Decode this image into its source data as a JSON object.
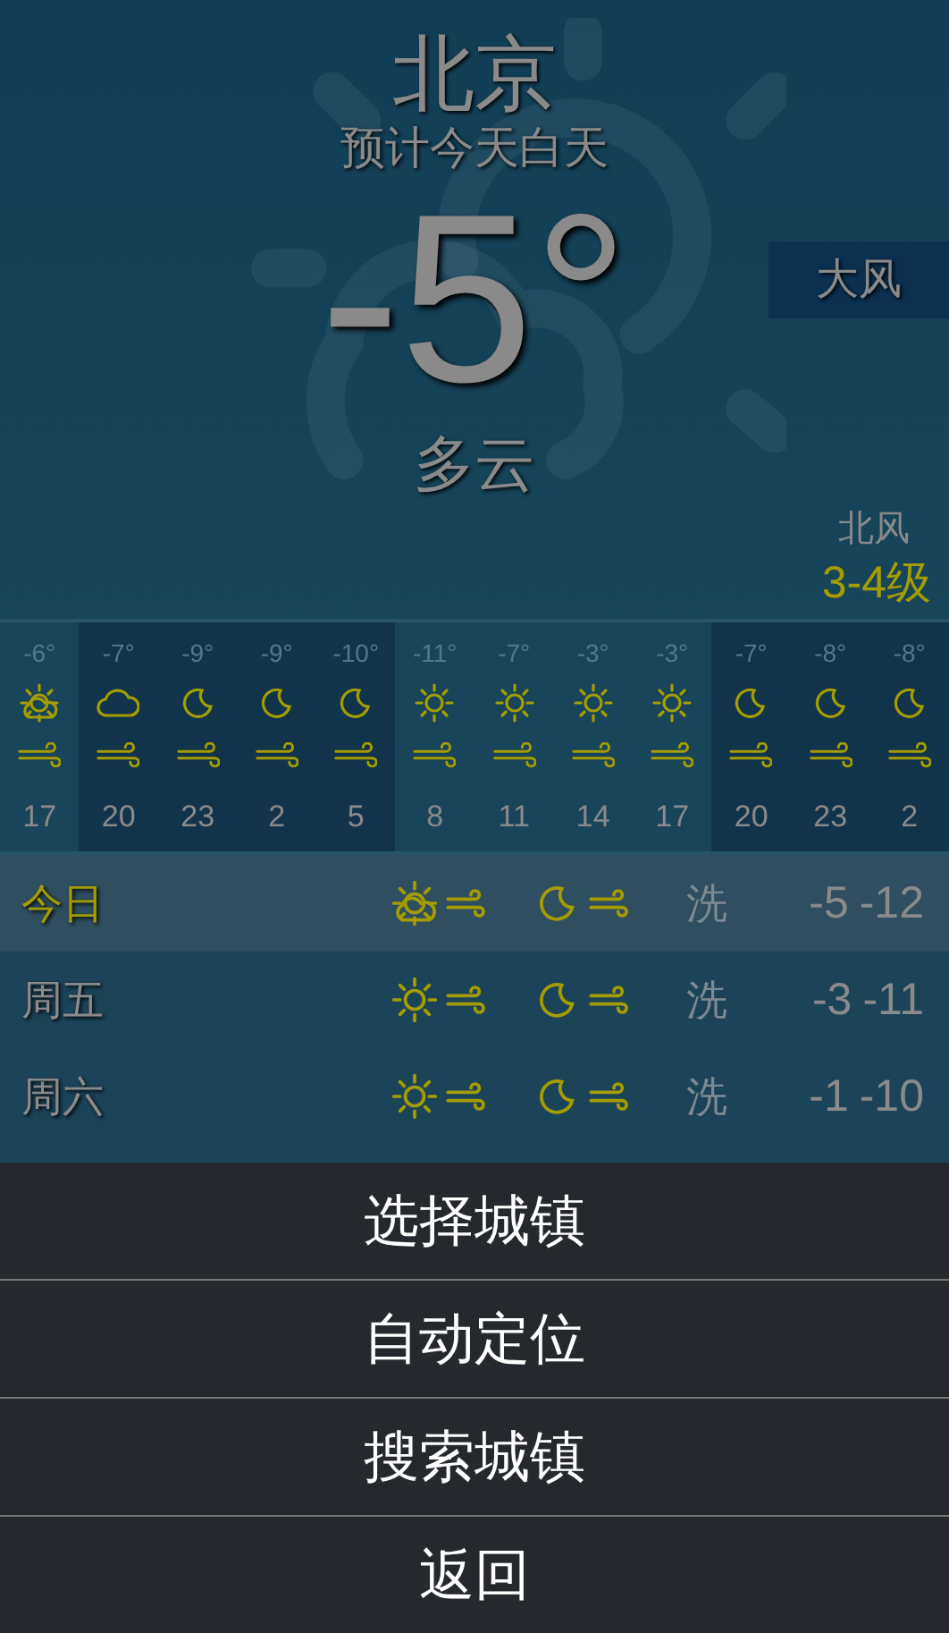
{
  "header": {
    "city": "北京",
    "subtitle": "预计今天白天",
    "temperature": "-5°",
    "condition": "多云",
    "alert": "大风",
    "wind_direction": "北风",
    "wind_level": "3-4级"
  },
  "hourly": [
    {
      "temp": "-6°",
      "kind": "sun-cloud",
      "night": false,
      "hour": "17"
    },
    {
      "temp": "-7°",
      "kind": "cloud",
      "night": true,
      "hour": "20"
    },
    {
      "temp": "-9°",
      "kind": "moon",
      "night": true,
      "hour": "23"
    },
    {
      "temp": "-9°",
      "kind": "moon",
      "night": true,
      "hour": "2"
    },
    {
      "temp": "-10°",
      "kind": "moon",
      "night": true,
      "hour": "5"
    },
    {
      "temp": "-11°",
      "kind": "sun",
      "night": false,
      "hour": "8"
    },
    {
      "temp": "-7°",
      "kind": "sun",
      "night": false,
      "hour": "11"
    },
    {
      "temp": "-3°",
      "kind": "sun",
      "night": false,
      "hour": "14"
    },
    {
      "temp": "-3°",
      "kind": "sun",
      "night": false,
      "hour": "17"
    },
    {
      "temp": "-7°",
      "kind": "moon",
      "night": true,
      "hour": "20"
    },
    {
      "temp": "-8°",
      "kind": "moon",
      "night": true,
      "hour": "23"
    },
    {
      "temp": "-8°",
      "kind": "moon",
      "night": true,
      "hour": "2"
    }
  ],
  "daily": [
    {
      "day": "今日",
      "selected": true,
      "day_weather": {
        "kind": "sun-cloud"
      },
      "night_weather": {
        "kind": "moon"
      },
      "index": "洗",
      "high": "-5",
      "low": "-12"
    },
    {
      "day": "周五",
      "selected": false,
      "day_weather": {
        "kind": "sun"
      },
      "night_weather": {
        "kind": "moon"
      },
      "index": "洗",
      "high": "-3",
      "low": "-11"
    },
    {
      "day": "周六",
      "selected": false,
      "day_weather": {
        "kind": "sun"
      },
      "night_weather": {
        "kind": "moon"
      },
      "index": "洗",
      "high": "-1",
      "low": "-10"
    }
  ],
  "menu": [
    {
      "label": "选择城镇"
    },
    {
      "label": "自动定位"
    },
    {
      "label": "搜索城镇"
    },
    {
      "label": "返回"
    }
  ]
}
